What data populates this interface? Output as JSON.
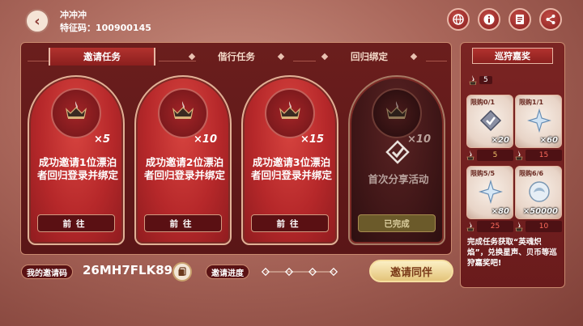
{
  "header": {
    "back_icon": "arrow-left-icon",
    "username": "冲冲冲",
    "feature_code": "特征码：100900145",
    "icons": [
      "globe-icon",
      "info-icon",
      "document-icon",
      "share-icon"
    ]
  },
  "tabs": [
    {
      "label": "邀请任务",
      "active": true
    },
    {
      "label": "偕行任务",
      "active": false
    },
    {
      "label": "回归绑定",
      "active": false
    }
  ],
  "cards": [
    {
      "multiplier": "×5",
      "desc": "成功邀请1位漂泊者回归登录并绑定",
      "button": "前往"
    },
    {
      "multiplier": "×10",
      "desc": "成功邀请2位漂泊者回归登录并绑定",
      "button": "前往"
    },
    {
      "multiplier": "×15",
      "desc": "成功邀请3位漂泊者回归登录并绑定",
      "button": "前往"
    },
    {
      "multiplier": "×10",
      "desc": "首次分享活动",
      "button": "已完成",
      "done": true
    }
  ],
  "bottom": {
    "code_label": "我的邀请码",
    "code_value": "26MH7FLK89",
    "progress_label": "邀请进度",
    "invite_button": "邀请同伴"
  },
  "reward_panel": {
    "title": "巡狩嘉奖",
    "flame_count": "5",
    "items": [
      {
        "limit": "限购0/1",
        "qty": "×20",
        "cost": "5",
        "cost_color": "#f3c46a"
      },
      {
        "limit": "限购1/1",
        "qty": "×60",
        "cost": "15",
        "cost_color": "#ff6b5c"
      },
      {
        "limit": "限购5/5",
        "qty": "×80",
        "cost": "25",
        "cost_color": "#ff6b5c"
      },
      {
        "limit": "限购6/6",
        "qty": "×50000",
        "cost": "10",
        "cost_color": "#ff6b5c"
      }
    ],
    "note": "完成任务获取“英魂炽焰”，兑换星声、贝币等巡狩嘉奖吧!"
  },
  "colors": {
    "accent_red": "#b2322e",
    "panel_dark": "#5a1617",
    "gold": "#f3c46a",
    "invite_button": "#e4c47a"
  }
}
